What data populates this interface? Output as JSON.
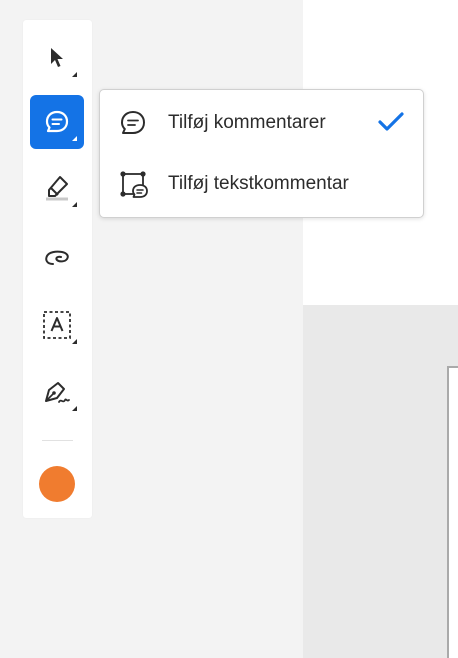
{
  "toolbar": {
    "tools": [
      {
        "name": "select-tool",
        "icon": "arrow-cursor-icon",
        "active": false
      },
      {
        "name": "add-comment-tool",
        "icon": "comment-bubble-icon",
        "active": true
      },
      {
        "name": "highlight-tool",
        "icon": "highlighter-icon",
        "active": false
      },
      {
        "name": "freehand-draw-tool",
        "icon": "lasso-icon",
        "active": false
      },
      {
        "name": "text-box-tool",
        "icon": "text-box-a-icon",
        "active": false
      },
      {
        "name": "signature-tool",
        "icon": "pen-sign-icon",
        "active": false
      }
    ],
    "active_color": "#f07c2f",
    "accent_color": "#1473e6"
  },
  "menu": {
    "items": [
      {
        "label": "Tilføj kommentarer",
        "icon": "comment-bubble-icon",
        "checked": true
      },
      {
        "label": "Tilføj tekstkommentar",
        "icon": "text-comment-icon",
        "checked": false
      }
    ]
  }
}
